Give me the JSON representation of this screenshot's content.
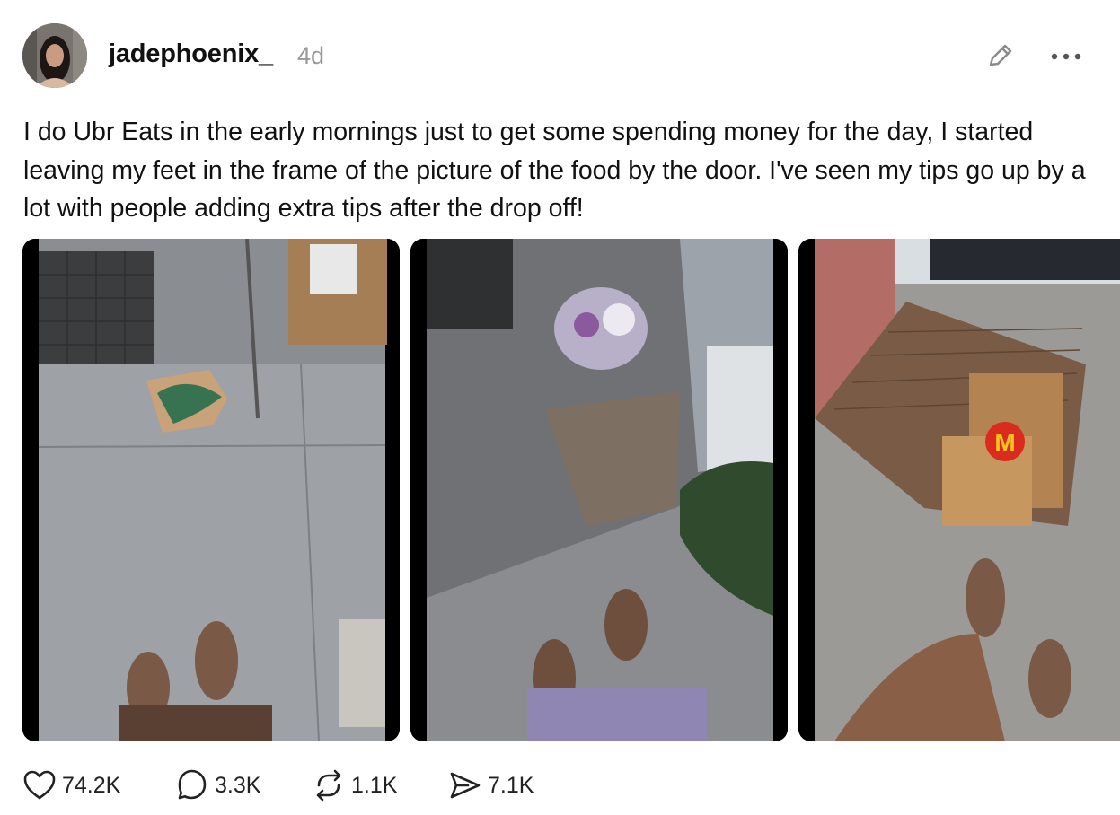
{
  "post": {
    "username": "jadephoenix_",
    "timestamp": "4d",
    "text": "I do Ubr Eats in the early mornings just to get some spending money for the day, I started leaving my feet in the frame of the picture of the food by the door. I've seen my tips go up by a lot with people adding extra tips after the drop off!",
    "images": [
      "starbucks-bag-delivery-photo",
      "flower-bouquet-delivery-photo",
      "mcdonalds-bags-delivery-photo"
    ]
  },
  "actions": {
    "likes": "74.2K",
    "replies": "3.3K",
    "reposts": "1.1K",
    "shares": "7.1K"
  },
  "icons": {
    "edit": "pencil-icon",
    "more": "more-options-icon",
    "like": "heart-icon",
    "reply": "comment-icon",
    "repost": "repost-icon",
    "share": "send-icon"
  }
}
